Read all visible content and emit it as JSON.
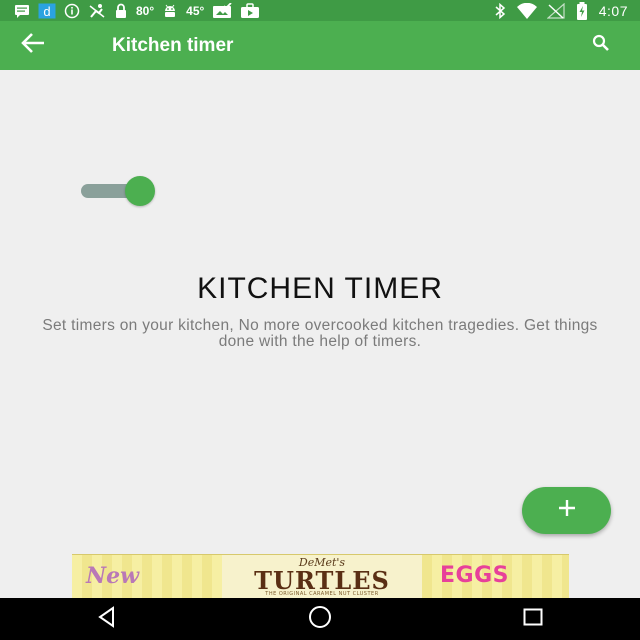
{
  "status_bar": {
    "icons_left": [
      "message-icon",
      "d-app-icon",
      "info-icon",
      "fitness-icon",
      "lock-icon"
    ],
    "temp_1": "80°",
    "android_icon": "android-icon",
    "temp_2": "45°",
    "icons_after": [
      "image-check-icon",
      "briefcase-icon"
    ],
    "icons_right": [
      "bluetooth-icon",
      "wifi-icon",
      "signal-off-icon",
      "battery-charging-icon"
    ],
    "time": "4:07"
  },
  "app_bar": {
    "title": "Kitchen timer",
    "color": "#4caf50",
    "status_color": "#3f9b45"
  },
  "toggle": {
    "state": "on"
  },
  "main": {
    "heading": "KITCHEN TIMER",
    "description": "Set timers on your kitchen, No more overcooked kitchen tragedies. Get things done with the help of timers."
  },
  "fab": {
    "label": "+"
  },
  "ad": {
    "left_text": "New",
    "brand": "DeMet's",
    "main_text": "TURTLES",
    "sub_text": "THE ORIGINAL CARAMEL NUT CLUSTER",
    "right_text": "EGGS"
  }
}
